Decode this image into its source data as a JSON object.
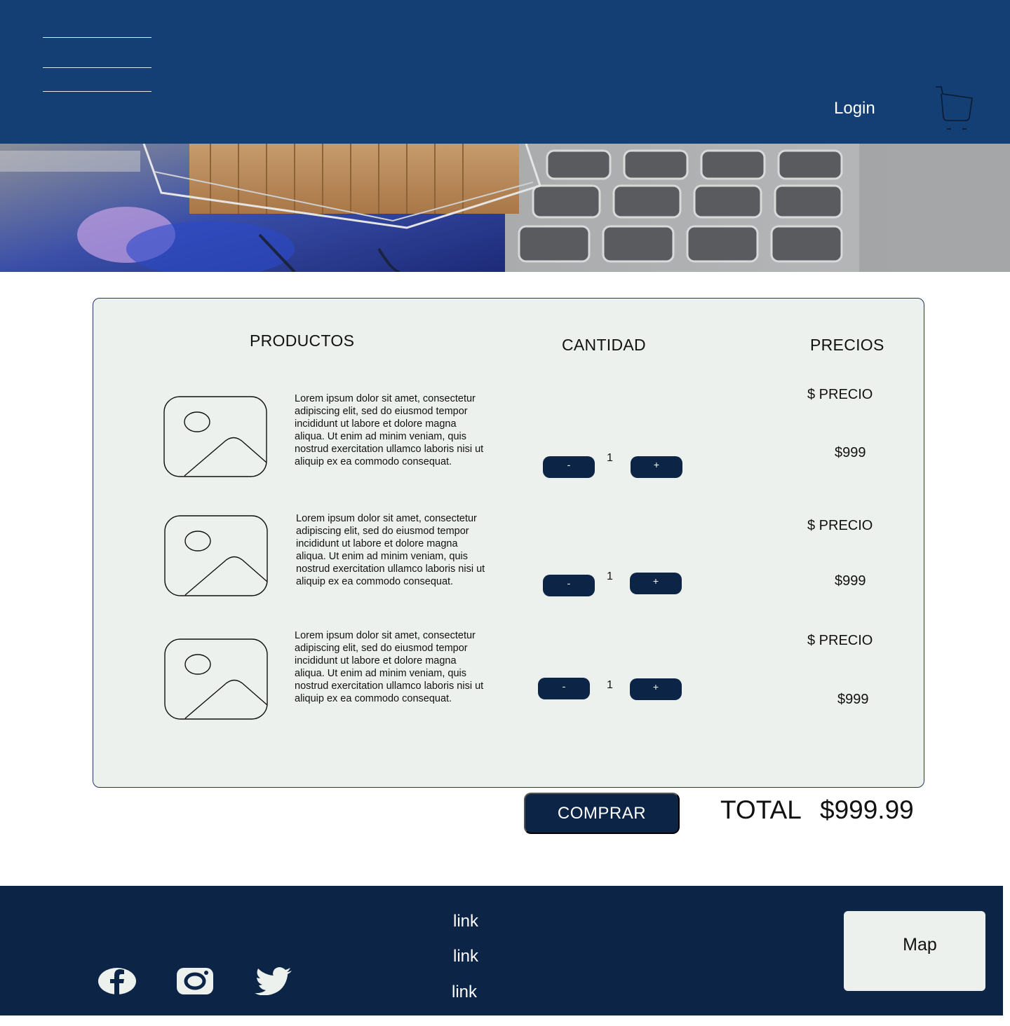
{
  "header": {
    "login_label": "Login"
  },
  "cart_table": {
    "headers": {
      "products": "PRODUCTOS",
      "quantity": "CANTIDAD",
      "prices": "PRECIOS"
    },
    "items": [
      {
        "description": "Lorem ipsum dolor sit amet, consectetur adipiscing elit, sed do eiusmod tempor incididunt ut labore et dolore magna aliqua. Ut enim ad minim veniam, quis nostrud exercitation ullamco laboris nisi ut aliquip ex ea commodo consequat.",
        "minus": "-",
        "plus": "+",
        "quantity": "1",
        "price_label": "$ PRECIO",
        "price": "$999"
      },
      {
        "description": "Lorem ipsum dolor sit amet, consectetur adipiscing elit, sed do eiusmod tempor incididunt ut labore et dolore magna aliqua. Ut enim ad minim veniam, quis nostrud exercitation ullamco laboris nisi ut aliquip ex ea commodo consequat.",
        "minus": "-",
        "plus": "+",
        "quantity": "1",
        "price_label": "$ PRECIO",
        "price": "$999"
      },
      {
        "description": "Lorem ipsum dolor sit amet, consectetur adipiscing elit, sed do eiusmod tempor incididunt ut labore et dolore magna aliqua. Ut enim ad minim veniam, quis nostrud exercitation ullamco laboris nisi ut aliquip ex ea commodo consequat.",
        "minus": "-",
        "plus": "+",
        "quantity": "1",
        "price_label": "$ PRECIO",
        "price": "$999"
      }
    ]
  },
  "checkout": {
    "buy_label": "COMPRAR",
    "total_label": "TOTAL",
    "total_value": "$999.99"
  },
  "footer": {
    "links": [
      "link",
      "link",
      "link"
    ],
    "map_label": "Map",
    "social_icons": [
      "facebook-icon",
      "instagram-icon",
      "twitter-icon"
    ]
  },
  "colors": {
    "header_bg": "#143f74",
    "footer_bg": "#0c2446",
    "panel_bg": "#edf1ed",
    "button_bg": "#0c2446"
  }
}
